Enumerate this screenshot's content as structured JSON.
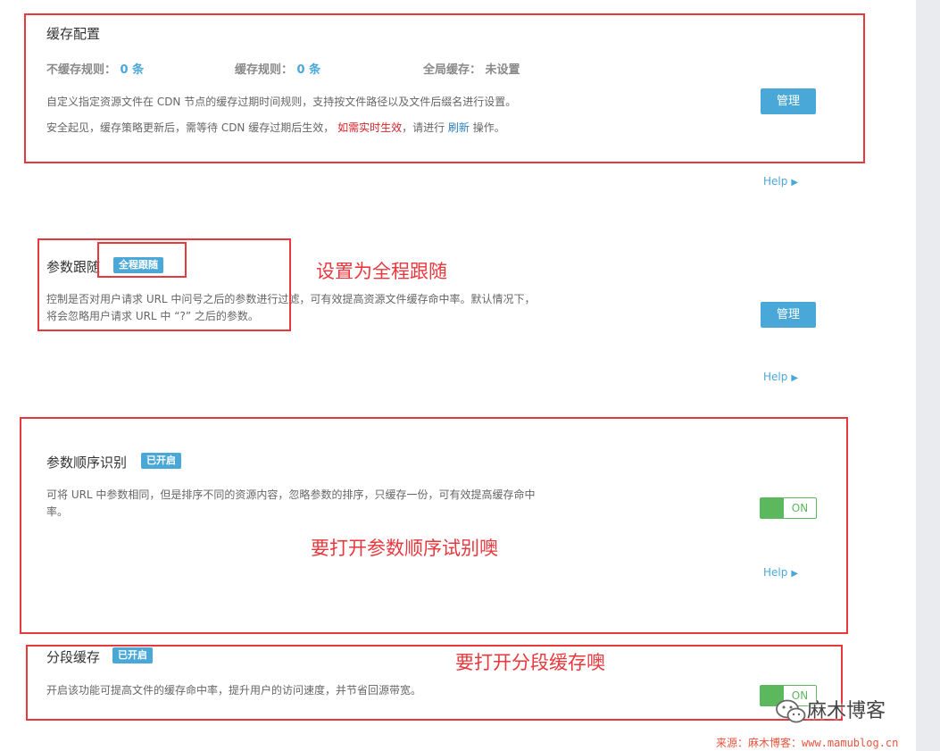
{
  "cache_config": {
    "title": "缓存配置",
    "no_cache_rules_label": "不缓存规则：",
    "no_cache_rules_count": "0 条",
    "cache_rules_label": "缓存规则：",
    "cache_rules_count": "0 条",
    "global_cache_label": "全局缓存：",
    "global_cache_value": "未设置",
    "desc_line1": "自定义指定资源文件在 CDN 节点的缓存过期时间规则，支持按文件路径以及文件后缀名进行设置。",
    "desc_line2_a": "安全起见，缓存策略更新后，需等待 CDN 缓存过期后生效，",
    "desc_line2_red": "如需实时生效",
    "desc_line2_b": "，请进行",
    "desc_line2_link": "刷新",
    "desc_line2_c": "操作。",
    "manage_label": "管理",
    "help_label": "Help"
  },
  "param_follow": {
    "title": "参数跟随",
    "badge": "全程跟随",
    "desc_line1": "控制是否对用户请求 URL 中问号之后的参数进行过滤，可有效提高资源文件缓存命中率。默认情况下，",
    "desc_line2": "将会忽略用户请求 URL 中 “?” 之后的参数。",
    "manage_label": "管理",
    "help_label": "Help",
    "annotation": "设置为全程跟随"
  },
  "param_order": {
    "title": "参数顺序识别",
    "badge": "已开启",
    "desc_line1": "可将 URL 中参数相同，但是排序不同的资源内容，忽略参数的排序，只缓存一份，可有效提高缓存命中",
    "desc_line2": "率。",
    "toggle_label": "ON",
    "toggle_on": true,
    "help_label": "Help",
    "annotation": "要打开参数顺序试别噢"
  },
  "range_cache": {
    "title": "分段缓存",
    "badge": "已开启",
    "desc": "开启该功能可提高文件的缓存命中率，提升用户的访问速度，并节省回源带宽。",
    "toggle_label": "ON",
    "toggle_on": true,
    "annotation": "要打开分段缓存噢"
  },
  "watermark": {
    "logo_text": "麻木博客",
    "source_text": "来源：麻木博客：www.mamublog.cn"
  },
  "icons": {
    "help_arrow": "▶",
    "wechat": "wechat-icon"
  },
  "colors": {
    "accent": "#4aa8d8",
    "toggle_green": "#5cb85c",
    "annotation_red": "#e8373d"
  }
}
